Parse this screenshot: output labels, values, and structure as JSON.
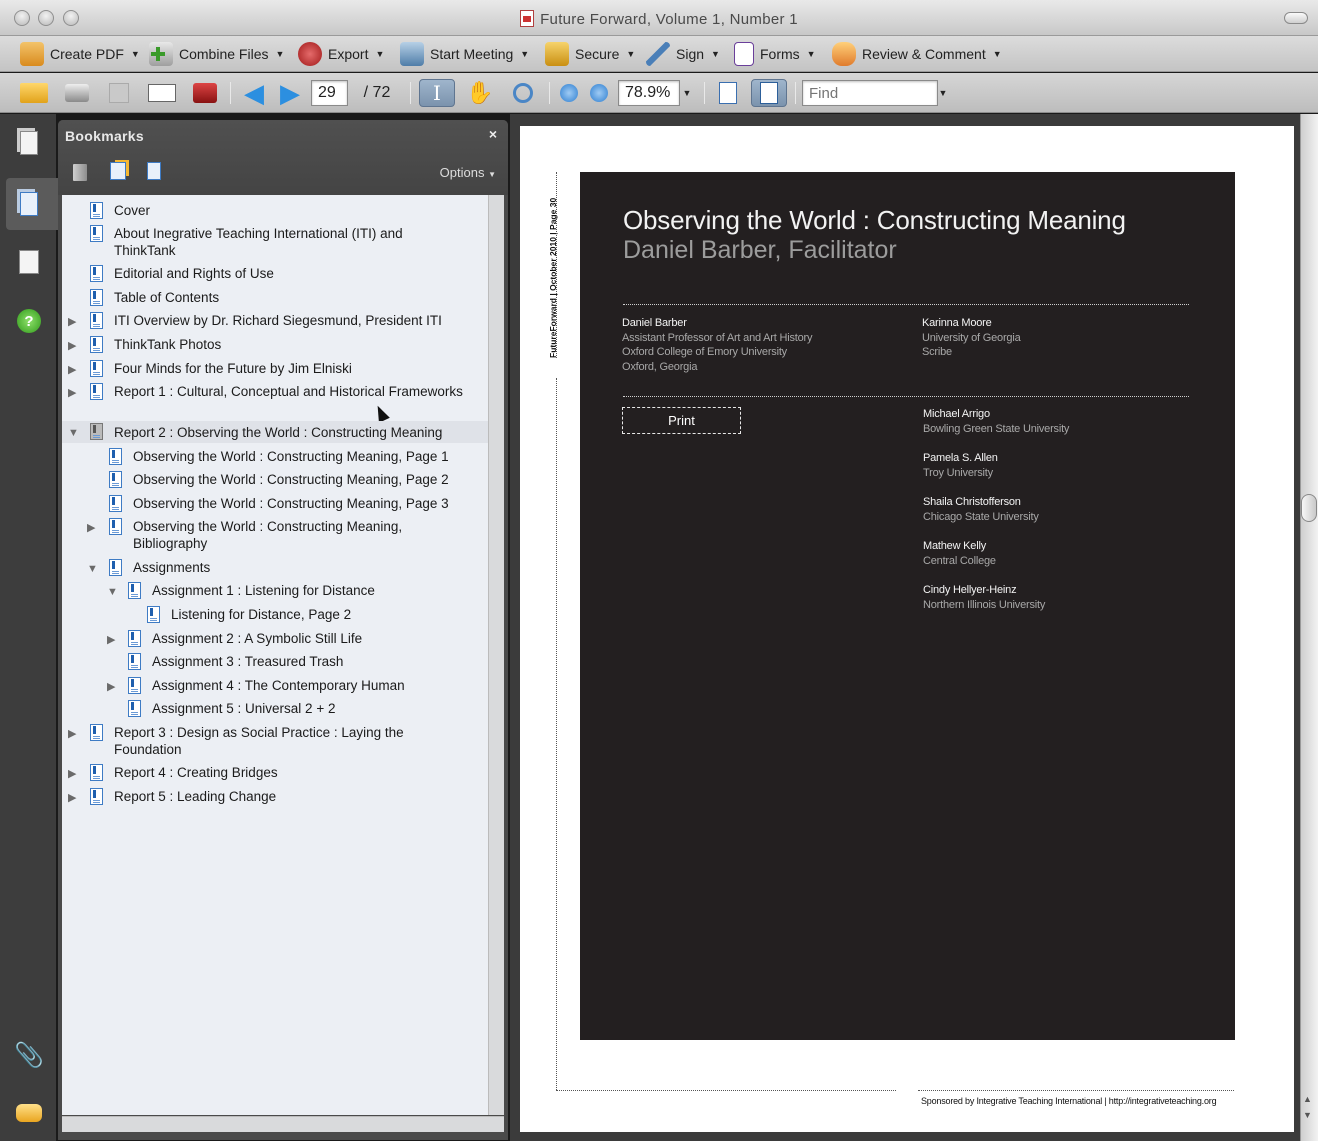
{
  "window": {
    "title": "Future Forward, Volume 1, Number 1"
  },
  "tasks": {
    "create_pdf": "Create PDF",
    "combine_files": "Combine Files",
    "export": "Export",
    "start_meeting": "Start Meeting",
    "secure": "Secure",
    "sign": "Sign",
    "forms": "Forms",
    "review_comment": "Review & Comment"
  },
  "navbar": {
    "page_current": "29",
    "page_total": "/ 72",
    "zoom": "78.9%",
    "find_placeholder": "Find"
  },
  "bookmarks": {
    "title": "Bookmarks",
    "close": "×",
    "options": "Options",
    "items": [
      {
        "label": "Cover"
      },
      {
        "label": "About Inegrative Teaching International (ITI) and",
        "label2": "ThinkTank"
      },
      {
        "label": "Editorial and Rights of Use"
      },
      {
        "label": "Table of Contents"
      },
      {
        "label": "ITI Overview by Dr. Richard Siegesmund, President ITI"
      },
      {
        "label": "ThinkTank Photos"
      },
      {
        "label": "Four Minds for the Future by Jim Elniski"
      },
      {
        "label": "Report 1 : Cultural, Conceptual and Historical Frameworks"
      },
      {
        "label": "Report 2 : Observing the World : Constructing Meaning"
      },
      {
        "label": "Observing the World : Constructing Meaning, Page 1"
      },
      {
        "label": "Observing the World : Constructing Meaning, Page 2"
      },
      {
        "label": "Observing the World : Constructing Meaning, Page 3"
      },
      {
        "label": "Observing the World : Constructing Meaning,",
        "label2": "Bibliography"
      },
      {
        "label": "Assignments"
      },
      {
        "label": "Assignment 1 : Listening for Distance"
      },
      {
        "label": "Listening for Distance, Page 2"
      },
      {
        "label": "Assignment 2 : A Symbolic Still Life"
      },
      {
        "label": "Assignment 3 : Treasured Trash"
      },
      {
        "label": "Assignment 4 : The Contemporary Human"
      },
      {
        "label": "Assignment 5 : Universal 2 + 2"
      },
      {
        "label": "Report 3 : Design as Social Practice : Laying the",
        "label2": "Foundation"
      },
      {
        "label": "Report 4 : Creating Bridges"
      },
      {
        "label": "Report 5 : Leading Change"
      }
    ]
  },
  "page": {
    "spine": "FutureForward  |  October 2010  |  Page 30",
    "title": "Observing the World : Constructing Meaning",
    "subtitle": "Daniel Barber, Facilitator",
    "print_label": "Print",
    "facilitator": {
      "name": "Daniel Barber",
      "lines": [
        "Assistant Professor of Art and Art History",
        "Oxford College of Emory University",
        "Oxford, Georgia"
      ]
    },
    "scribe": {
      "name": "Karinna Moore",
      "lines": [
        "University of Georgia",
        "Scribe"
      ]
    },
    "members": [
      {
        "name": "Michael Arrigo",
        "org": "Bowling Green State University"
      },
      {
        "name": "Pamela S. Allen",
        "org": "Troy University"
      },
      {
        "name": "Shaila Christofferson",
        "org": "Chicago State University"
      },
      {
        "name": "Mathew Kelly",
        "org": "Central College"
      },
      {
        "name": "Cindy Hellyer-Heinz",
        "org": "Northern Illinois University"
      }
    ],
    "footer": "Sponsored by Integrative Teaching International   |   http://integrativeteaching.org"
  }
}
